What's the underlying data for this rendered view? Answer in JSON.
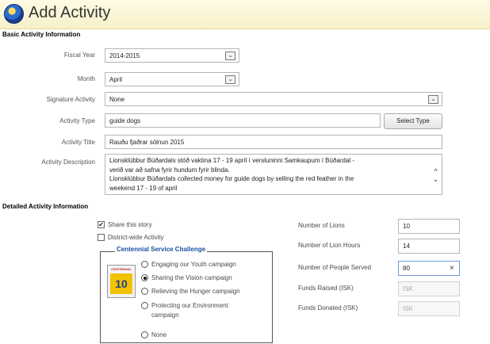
{
  "title": "Add Activity",
  "basic": {
    "section_title": "Basic Activity Information",
    "fiscal_year": {
      "label": "Fiscal Year",
      "value": "2014-2015"
    },
    "month": {
      "label": "Month",
      "value": "April"
    },
    "signature": {
      "label": "Signature Activity",
      "value": "None"
    },
    "activity_type": {
      "label": "Activity Type",
      "value": "guide dogs",
      "button": "Select Type"
    },
    "activity_title": {
      "label": "Activity Title",
      "value": "Rauðu fjaðrar sölnun 2015"
    },
    "description": {
      "label": "Activity Description",
      "lines": [
        "Lionsklúbbur Búðardals stóð vaktina 17 - 19 apríl í versluninni Samkaupum í Búðardal -",
        "verið var að safna fyrir hundum fyrir blinda.",
        "Lionsklúbbur Búðardals collected money for guide dogs by selling the red feather in the",
        "weekend 17 - 19 of april"
      ],
      "scroll_up": "^",
      "scroll_down": "⌄"
    }
  },
  "detailed": {
    "section_title": "Detailed Activity Information",
    "share_story": {
      "label": "Share this story",
      "mark": "✔"
    },
    "district_wide": {
      "label": "District-wide Activity"
    },
    "challenge": {
      "legend": "Centennial Service Challenge",
      "icon_text": "CENTENNIAL",
      "icon_number": "10",
      "options": [
        "Engaging our Youth campaign",
        "Sharing the Vision campaign",
        "Relieving the Hunger campaign",
        "Protecting our Environment",
        "campaign",
        "None"
      ]
    },
    "number_of_lions": {
      "label": "Number of Lions",
      "value": "10"
    },
    "lion_hours": {
      "label": "Number of Lion Hours",
      "value": "14"
    },
    "people_served": {
      "label": "Number of People Served",
      "value": "80",
      "clear": "×"
    },
    "funds_raised": {
      "label": "Funds Raised (ISK)",
      "placeholder": "ISK"
    },
    "funds_donated": {
      "label": "Funds Donated (ISK)",
      "placeholder": "ISK"
    }
  },
  "dropdown_glyph": "⌄"
}
